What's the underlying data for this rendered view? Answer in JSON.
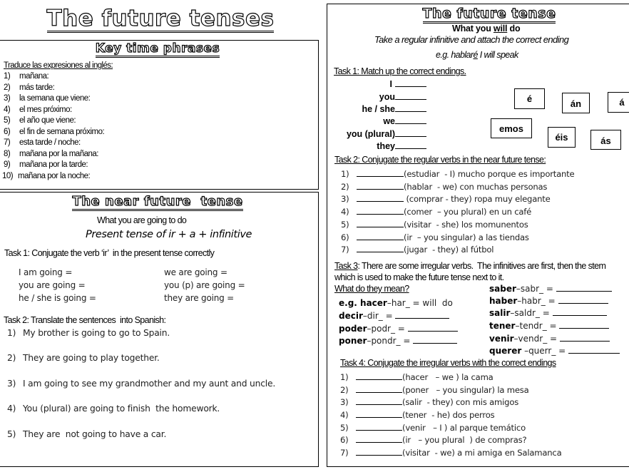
{
  "main_title": "The future tenses",
  "key_time_phrases": {
    "title": "Key time phrases",
    "instruction": "Traduce las expresiones al inglés:",
    "items": [
      {
        "num": "1)",
        "text": "mañana:"
      },
      {
        "num": "2)",
        "text": "más tarde:"
      },
      {
        "num": "3)",
        "text": "la semana que viene:"
      },
      {
        "num": "4)",
        "text": "el mes próximo:"
      },
      {
        "num": "5)",
        "text": "el año que viene:"
      },
      {
        "num": "6)",
        "text": "el fin de semana próximo:"
      },
      {
        "num": "7)",
        "text": "esta tarde / noche:"
      },
      {
        "num": "8)",
        "text": "mañana por la mañana:"
      },
      {
        "num": "9)",
        "text": "mañana por la tarde:"
      },
      {
        "num": "10)",
        "text": "mañana por la noche:"
      }
    ]
  },
  "near_future": {
    "title": "The near future  tense",
    "subtitle": "What you are going to do",
    "formula": "Present tense of ir + a + infinitive",
    "task1": {
      "heading": "Task 1: Conjugate the verb ‘ir’  in the present tense correctly",
      "left": [
        "I am going =",
        "you are going =",
        "he / she is going ="
      ],
      "right": [
        "we are going =",
        "you (p) are going =",
        "they are going ="
      ]
    },
    "task2": {
      "heading": "Task 2: Translate the sentences  into Spanish:",
      "items": [
        {
          "num": "1)",
          "text": "My brother is going to go to Spain."
        },
        {
          "num": "2)",
          "text": "They are going to play together."
        },
        {
          "num": "3)",
          "text": "I am going to see my grandmother and my aunt and uncle."
        },
        {
          "num": "4)",
          "text": "You (plural) are going to finish  the homework."
        },
        {
          "num": "5)",
          "text": "They are  not going to have a car."
        }
      ]
    }
  },
  "future": {
    "title": "The future tense",
    "subtitle_pre": "What you ",
    "subtitle_will": "will",
    "subtitle_post": " do",
    "instruction": "Take a regular infinitive and attach the correct ending",
    "example_pre": "e.g. hablar",
    "example_ending": "é",
    "example_post": " I will speak",
    "task1": {
      "heading": "Task 1: Match up the correct endings.",
      "pronouns": [
        "I",
        "you",
        "he / she",
        "we",
        "you (plural)",
        "they"
      ],
      "endings": [
        "é",
        "án",
        "á",
        "emos",
        "éis",
        "ás"
      ]
    },
    "task2": {
      "heading": "Task 2: Conjugate the regular verbs in the near future tense:",
      "items": [
        {
          "num": "1)",
          "text": "(estudiar  - I) mucho porque es importante"
        },
        {
          "num": "2)",
          "text": "(hablar  - we) con muchas personas"
        },
        {
          "num": "3)",
          "text": " (comprar - they) ropa muy elegante"
        },
        {
          "num": "4)",
          "text": "(comer  – you plural) en un café"
        },
        {
          "num": "5)",
          "text": "(visitar  - she) los momunentos"
        },
        {
          "num": "6)",
          "text": "(ir  – you singular) a las tiendas"
        },
        {
          "num": "7)",
          "text": "(jugar  - they) al fútbol"
        }
      ]
    },
    "task3": {
      "heading_label": "Task 3",
      "heading_text": ": There are some irregular verbs.  The infinitives are first, then the stem",
      "heading_line2": "which is used to make the future tense next to it.",
      "question": "What do they mean?",
      "left": [
        {
          "prefix": "e.g. ",
          "inf": "hacer",
          "stem": "–har_ = will  do",
          "blank": false
        },
        {
          "prefix": "",
          "inf": "decir",
          "stem": "–dir_ = ",
          "blank": true
        },
        {
          "prefix": "",
          "inf": "poder",
          "stem": "–podr_ = ",
          "blank": true
        },
        {
          "prefix": "",
          "inf": "poner",
          "stem": "–pondr_ = ",
          "blank": true
        }
      ],
      "right": [
        {
          "inf": "saber",
          "stem": "–sabr_ = "
        },
        {
          "inf": "haber",
          "stem": "–habr_ = "
        },
        {
          "inf": "salir",
          "stem": "–saldr_ = "
        },
        {
          "inf": "tener",
          "stem": "–tendr_ = "
        },
        {
          "inf": "venir",
          "stem": "–vendr_ = "
        },
        {
          "inf": "querer",
          "stem": " –querr_ = "
        }
      ]
    },
    "task4": {
      "heading": "Task 4: Conjugate the irregular verbs with the correct endings",
      "items": [
        {
          "num": "1)",
          "text": "(hacer   – we ) la cama"
        },
        {
          "num": "2)",
          "text": "(poner   – you singular) la mesa"
        },
        {
          "num": "3)",
          "text": "(salir  - they) con mis amigos"
        },
        {
          "num": "4)",
          "text": "(tener  - he) dos perros"
        },
        {
          "num": "5)",
          "text": "(venir   – I ) al parque temático"
        },
        {
          "num": "6)",
          "text": "(ir   – you plural  ) de compras?"
        },
        {
          "num": "7)",
          "text": "(visitar  - we) a mi amiga en Salamanca"
        }
      ]
    }
  }
}
